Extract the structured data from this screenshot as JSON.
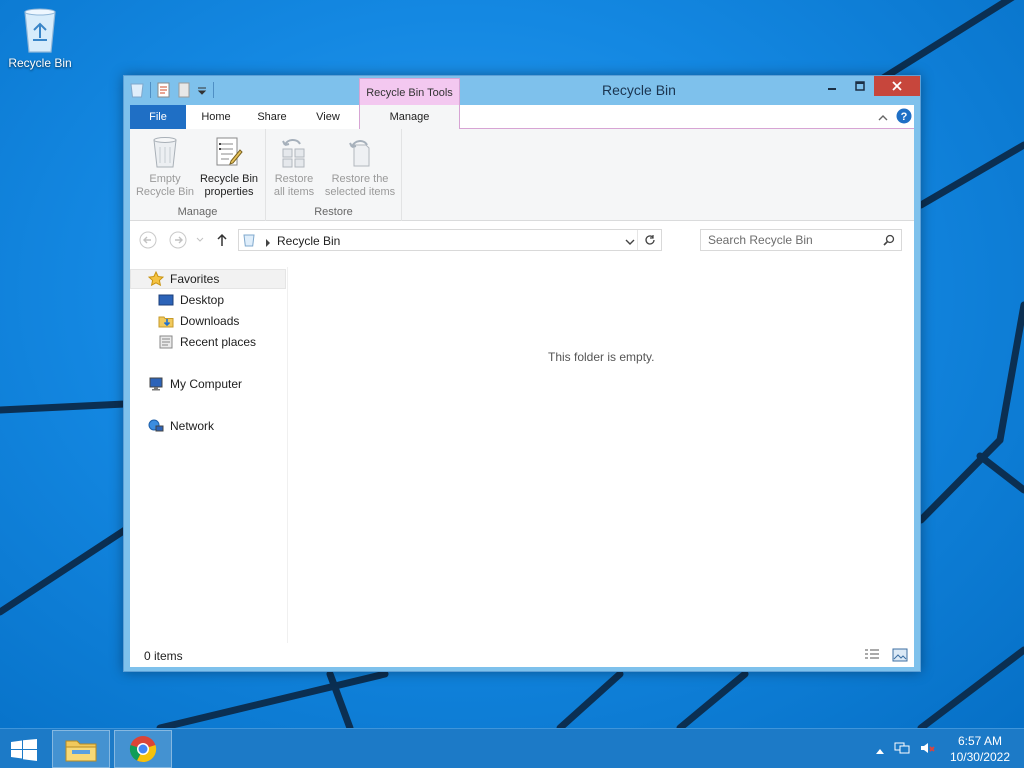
{
  "desktop": {
    "icons": [
      {
        "label": "Recycle Bin",
        "icon": "recycle-bin-icon"
      }
    ]
  },
  "window": {
    "title": "Recycle Bin",
    "context_tab_group": "Recycle Bin Tools",
    "tabs": {
      "file": "File",
      "home": "Home",
      "share": "Share",
      "view": "View",
      "manage": "Manage"
    },
    "ribbon": {
      "groups": [
        {
          "label": "Manage",
          "buttons": [
            {
              "line1": "Empty",
              "line2": "Recycle Bin",
              "enabled": false
            },
            {
              "line1": "Recycle Bin",
              "line2": "properties",
              "enabled": true
            }
          ]
        },
        {
          "label": "Restore",
          "buttons": [
            {
              "line1": "Restore",
              "line2": "all items",
              "enabled": false
            },
            {
              "line1": "Restore the",
              "line2": "selected items",
              "enabled": false
            }
          ]
        }
      ]
    },
    "address": {
      "breadcrumb": "Recycle Bin",
      "search_placeholder": "Search Recycle Bin"
    },
    "nav_pane": {
      "favorites": "Favorites",
      "desktop": "Desktop",
      "downloads": "Downloads",
      "recent": "Recent places",
      "computer": "My Computer",
      "network": "Network"
    },
    "content": {
      "empty_message": "This folder is empty."
    },
    "status": {
      "item_count": "0 items"
    }
  },
  "taskbar": {
    "time": "6:57 AM",
    "date": "10/30/2022"
  },
  "colors": {
    "file_tab": "#1f6fc5",
    "context_tab": "#f3c8f0",
    "close_button": "#c7463c",
    "taskbar": "#1c7ac7"
  }
}
